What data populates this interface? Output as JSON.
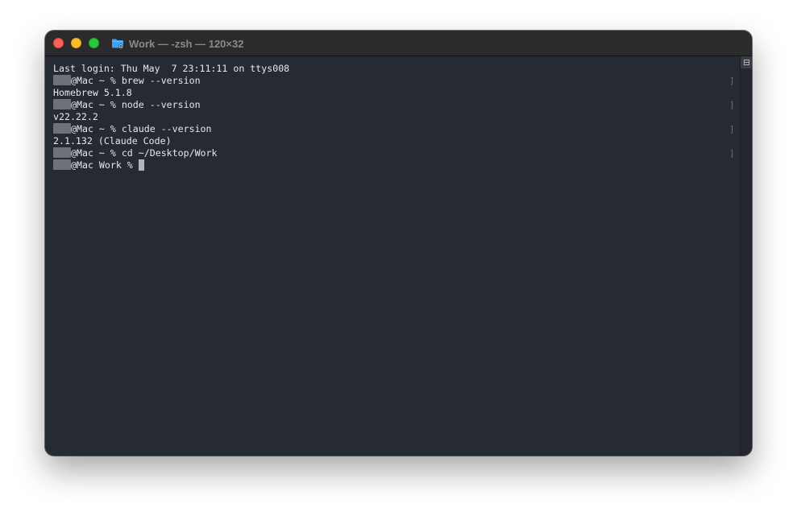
{
  "window": {
    "title": "Work — -zsh — 120×32",
    "controls": {
      "close": "close",
      "minimize": "minimize",
      "zoom": "zoom"
    }
  },
  "terminal": {
    "last_login": "Last login: Thu May  7 23:11:11 on ttys008",
    "commands": [
      {
        "prompt": "@Mac ~ % ",
        "command": "brew --version",
        "output": "Homebrew 5.1.8"
      },
      {
        "prompt": "@Mac ~ % ",
        "command": "node --version",
        "output": "v22.22.2"
      },
      {
        "prompt": "@Mac ~ % ",
        "command": "claude --version",
        "output": "2.1.132 (Claude Code)"
      },
      {
        "prompt": "@Mac ~ % ",
        "command": "cd ~/Desktop/Work",
        "output": ""
      }
    ],
    "current_prompt": "@Mac Work % ",
    "mark_glyph": "]"
  },
  "colors": {
    "background": "#262a33",
    "text": "#e8e8e8",
    "title_text": "#8a8a8c",
    "close": "#fe5f57",
    "minimize": "#febc2e",
    "zoom": "#28c840",
    "folder_accent": "#3ba2f5"
  },
  "icons": {
    "title": "folder-icon",
    "scrollbar": "split-pane-icon"
  }
}
